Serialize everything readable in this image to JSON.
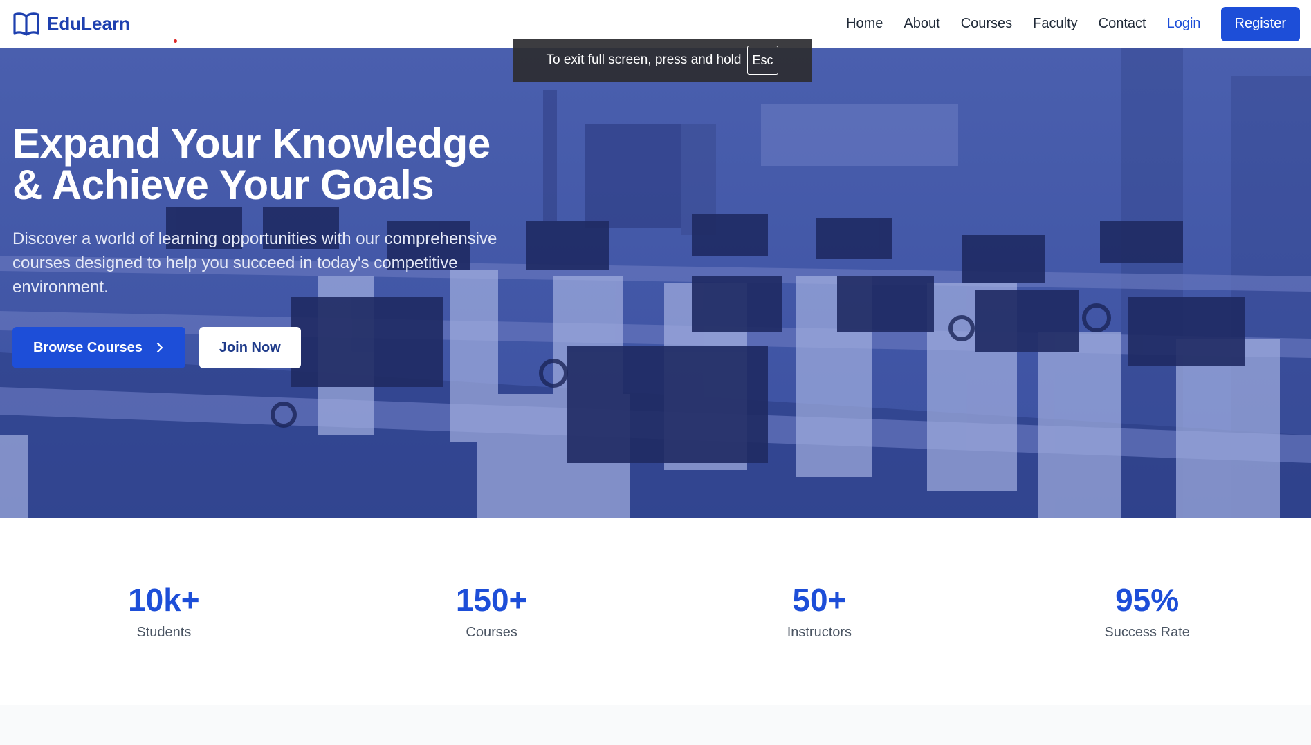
{
  "brand": {
    "name": "EduLearn",
    "icon": "open-book-icon",
    "color": "#1e40af"
  },
  "nav": {
    "links": [
      "Home",
      "About",
      "Courses",
      "Faculty",
      "Contact"
    ],
    "login_label": "Login",
    "register_label": "Register"
  },
  "fullscreen_notice": {
    "text": "To exit full screen, press and hold",
    "key": "Esc"
  },
  "hero": {
    "title_line1": "Expand Your Knowledge",
    "title_line2": "& Achieve Your Goals",
    "subtitle": "Discover a world of learning opportunities with our comprehensive courses designed to help you succeed in today's competitive environment.",
    "browse_label": "Browse Courses",
    "browse_icon": "chevron-right-icon",
    "join_label": "Join Now",
    "background": "computer-lab-photo"
  },
  "stats": [
    {
      "value": "10k+",
      "label": "Students"
    },
    {
      "value": "150+",
      "label": "Courses"
    },
    {
      "value": "50+",
      "label": "Instructors"
    },
    {
      "value": "95%",
      "label": "Success Rate"
    }
  ],
  "colors": {
    "accent": "#1d4ed8",
    "hero_overlay": "#34489a",
    "text": "#1f2937",
    "muted": "#4b5563"
  }
}
